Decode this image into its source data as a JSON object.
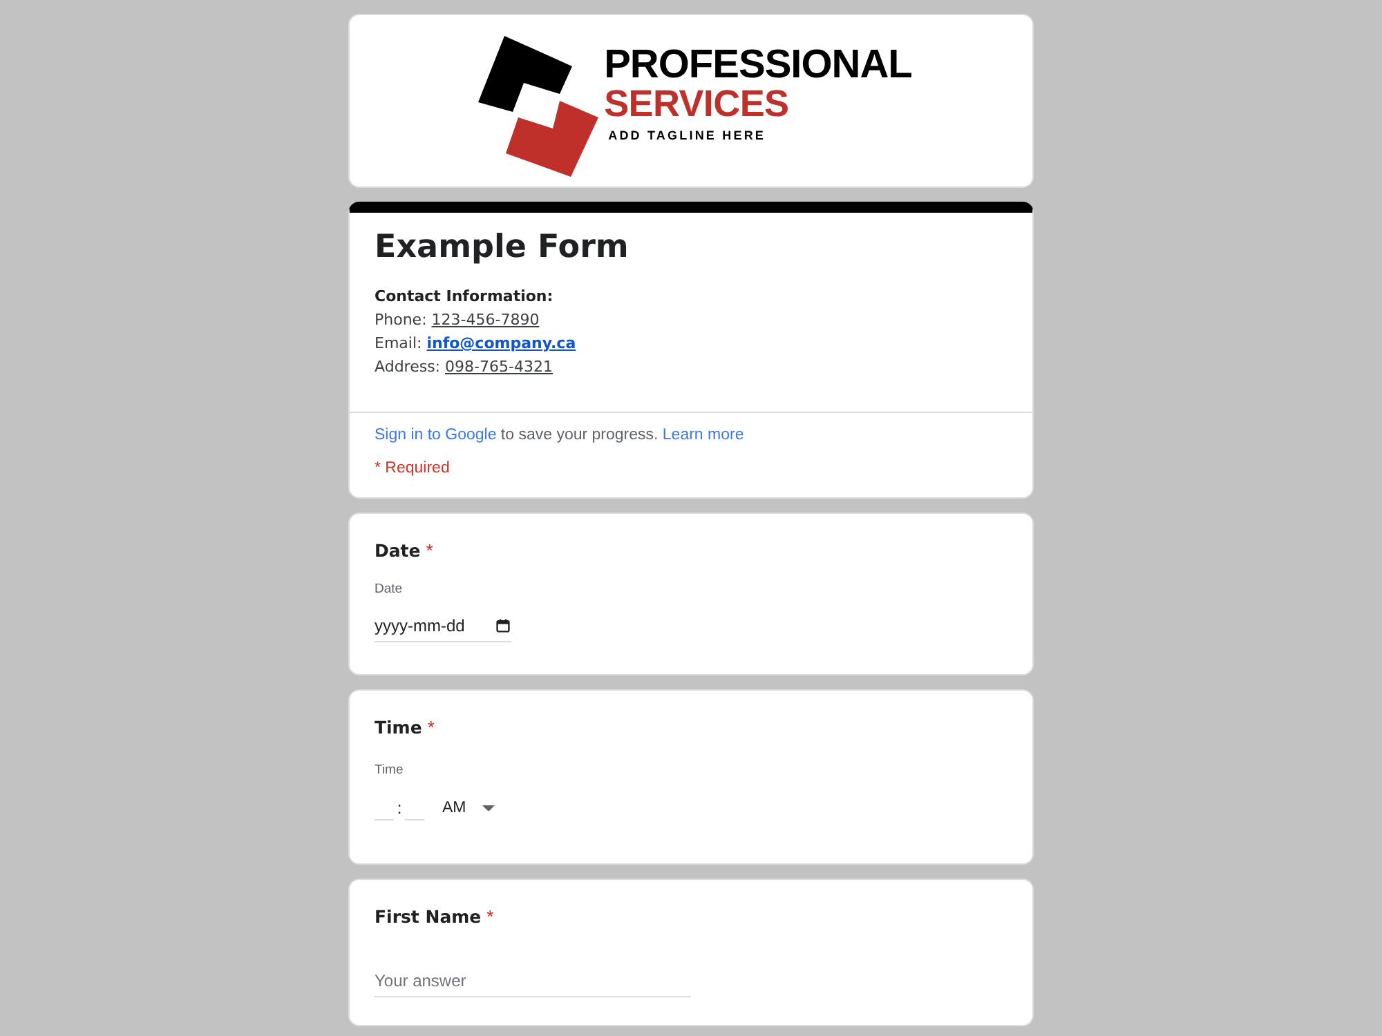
{
  "logo": {
    "name": "PROFESSIONAL",
    "subtitle": "SERVICES",
    "tagline": "ADD TAGLINE HERE"
  },
  "header": {
    "title": "Example Form",
    "contact_heading": "Contact Information:",
    "contacts": [
      {
        "label": "Phone:",
        "value": "123-456-7890",
        "kind": "plain"
      },
      {
        "label": "Email:",
        "value": "info@company.ca",
        "kind": "email"
      },
      {
        "label": "Address:",
        "value": "098-765-4321",
        "kind": "plain"
      }
    ],
    "sign_in": {
      "link": "Sign in to Google",
      "text": "to save your progress.",
      "learn_more": "Learn more"
    },
    "required_note": "* Required"
  },
  "questions": [
    {
      "kind": "date",
      "title": "Date",
      "required_mark": "*",
      "label": "Date",
      "placeholder": "yyyy-mm-dd"
    },
    {
      "kind": "time",
      "title": "Time",
      "required_mark": "*",
      "label": "Time",
      "separator": ":",
      "period": "AM"
    },
    {
      "kind": "text",
      "title": "First Name",
      "required_mark": "*",
      "placeholder": "Your answer"
    }
  ]
}
